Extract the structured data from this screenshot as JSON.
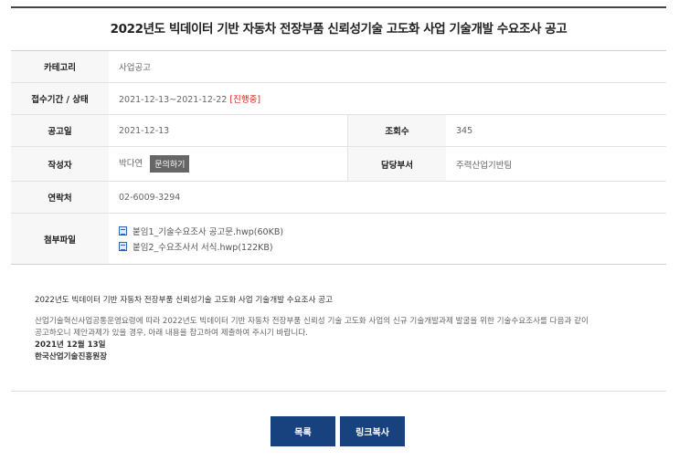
{
  "title": "2022년도 빅데이터 기반 자동차 전장부품 신뢰성기술 고도화 사업 기술개발 수요조사 공고",
  "info": {
    "category_label": "카테고리",
    "category_value": "사업공고",
    "period_label": "접수기간 / 상태",
    "period_value": "2021-12-13~2021-12-22",
    "status_value": "[진행중]",
    "date_label": "공고일",
    "date_value": "2021-12-13",
    "views_label": "조회수",
    "views_value": "345",
    "author_label": "작성자",
    "author_value": "박다연",
    "ask_button": "문의하기",
    "dept_label": "담당부서",
    "dept_value": "주력산업기반팀",
    "contact_label": "연락처",
    "contact_value": "02-6009-3294",
    "attach_label": "첨부파일",
    "attachments": [
      "붙임1_기술수요조사 공고문.hwp(60KB)",
      "붙임2_수요조사서 서식.hwp(122KB)"
    ]
  },
  "content": {
    "heading": "2022년도 빅데이터 기반 자동차 전장부품 신뢰성기술 고도화 사업 기술개발 수요조사 공고",
    "line1": "산업기술혁신사업공통운영요령에 따라 2022년도 빅데이터 기반 자동차 전장부품 신뢰성 기술 고도화 사업의 신규 기술개발과제 발굴을 위한 기술수요조사를 다음과 같이",
    "line2": "공고하오니 제안과제가 있을 경우, 아래 내용을 참고하여 제출하여 주시기 바랍니다.",
    "date": "2021년 12월 13일",
    "org": "한국산업기술진흥원장"
  },
  "buttons": {
    "list": "목록",
    "copy_link": "링크복사"
  }
}
